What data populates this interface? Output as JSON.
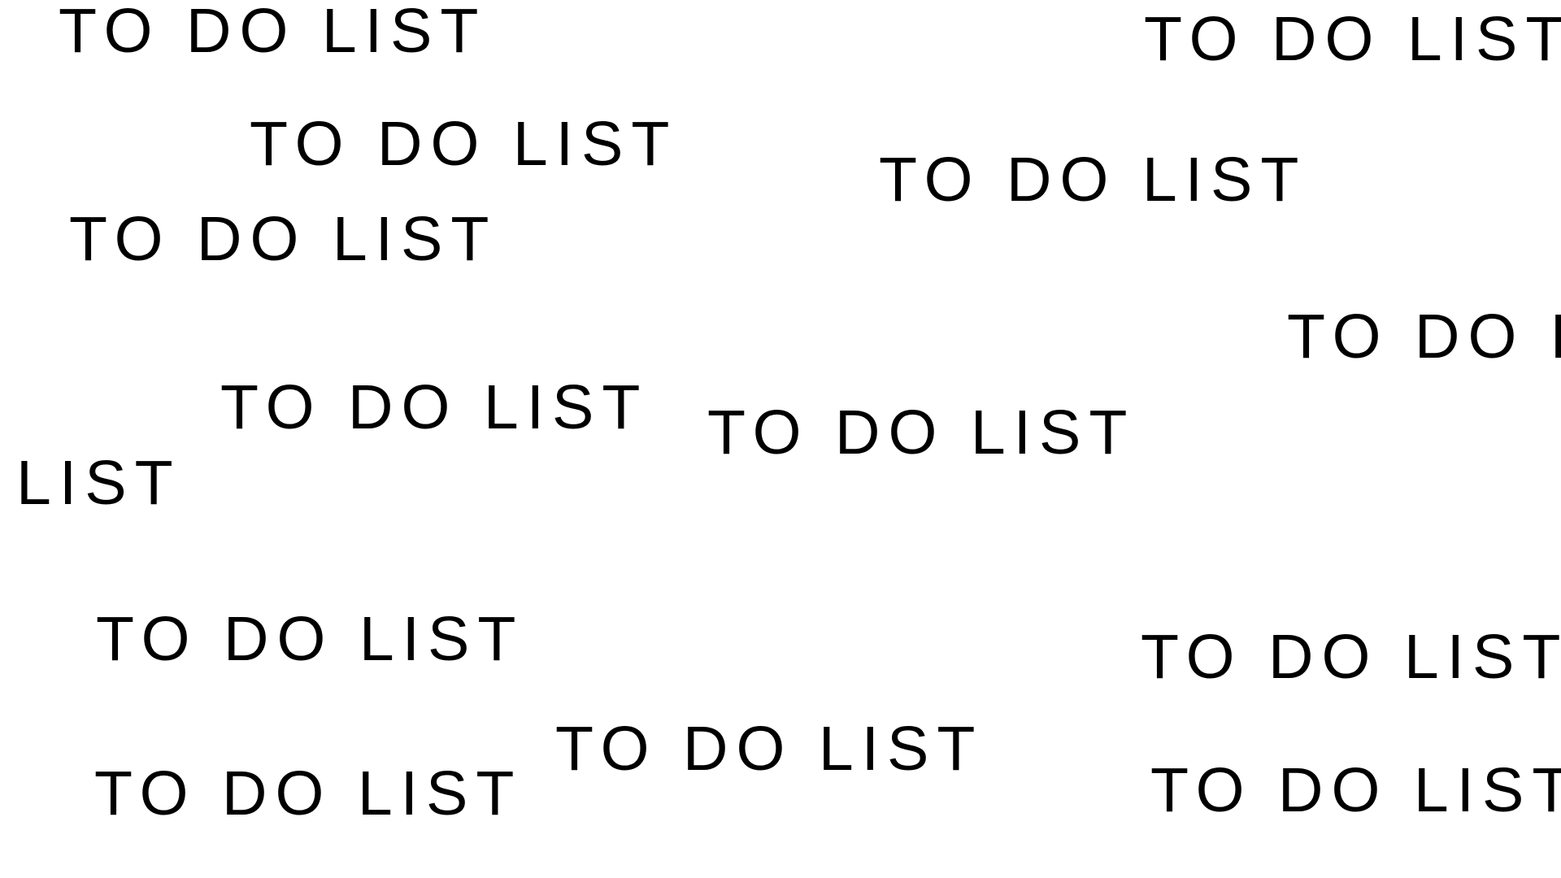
{
  "texts": [
    "TO DO LIST",
    "TO DO LIST",
    "TO DO LIST",
    "TO DO LIST",
    "TO DO LIST",
    "TO DO LIST",
    "TO DO LIST",
    "TO DO LIST",
    "LIST",
    "TO DO LIST",
    "TO DO LIST",
    "TO DO LIST",
    "TO DO LIST",
    "TO DO LIST"
  ],
  "colors": {
    "background": "#ffffff",
    "text": "#000000"
  }
}
